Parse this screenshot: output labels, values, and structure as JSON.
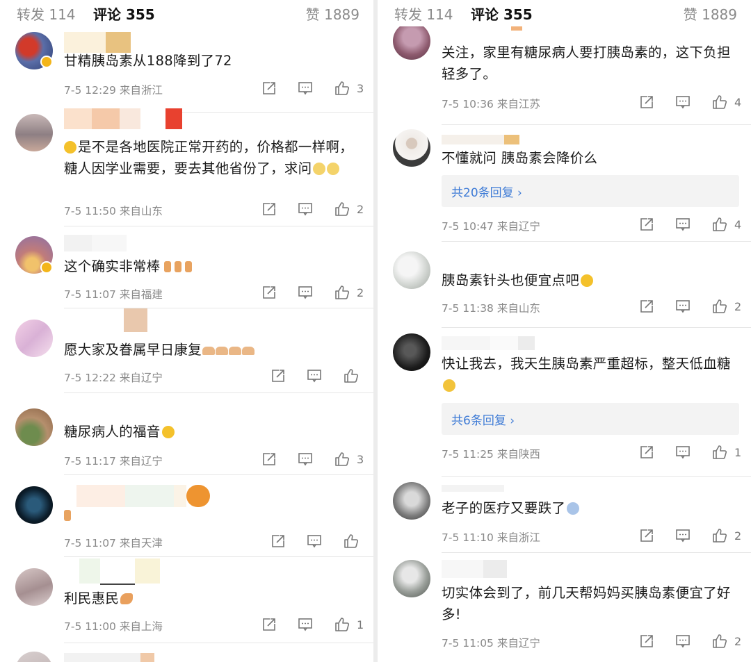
{
  "tabs": {
    "repost": "转发 114",
    "comments": "评论 355",
    "likes": "赞 1889"
  },
  "accent_link": "#3e7bd6",
  "icons": {
    "share": "share-icon",
    "comment": "comment-icon",
    "like": "thumbs-up-icon"
  },
  "left": [
    {
      "text": "甘精胰岛素从188降到了72",
      "time": "7-5 12:29 来自浙江",
      "likes": "3"
    },
    {
      "text": "是不是各地医院正常开药的，价格都一样啊，糖人因学业需要，要去其他省份了，求问",
      "time": "7-5 11:50 来自山东",
      "likes": "2"
    },
    {
      "text": "这个确实非常棒",
      "time": "7-5 11:07 来自福建",
      "likes": "2"
    },
    {
      "text": "愿大家及眷属早日康复",
      "time": "7-5 12:22 来自辽宁",
      "likes": ""
    },
    {
      "text": "糖尿病人的福音",
      "time": "7-5 11:17 来自辽宁",
      "likes": "3"
    },
    {
      "text": "",
      "time": "7-5 11:07 来自天津",
      "likes": ""
    },
    {
      "text": "利民惠民",
      "time": "7-5 11:00 来自上海",
      "likes": "1"
    }
  ],
  "right": [
    {
      "text": "关注，家里有糖尿病人要打胰岛素的，这下负担轻多了。",
      "time": "7-5 10:36 来自江苏",
      "likes": "4"
    },
    {
      "text": "不懂就问 胰岛素会降价么",
      "replies": "共20条回复 ›",
      "time": "7-5 10:47 来自辽宁",
      "likes": "4"
    },
    {
      "text": "胰岛素针头也便宜点吧",
      "time": "7-5 11:38 来自山东",
      "likes": "2"
    },
    {
      "text": "快让我去，我天生胰岛素严重超标，整天低血糖",
      "replies": "共6条回复 ›",
      "time": "7-5 11:25 来自陕西",
      "likes": "1"
    },
    {
      "text": "老子的医疗又要跌了",
      "time": "7-5 11:10 来自浙江",
      "likes": "2"
    },
    {
      "text": "切实体会到了，前几天帮妈妈买胰岛素便宜了好多!",
      "time": "7-5 11:05 来自辽宁",
      "likes": "2"
    }
  ]
}
